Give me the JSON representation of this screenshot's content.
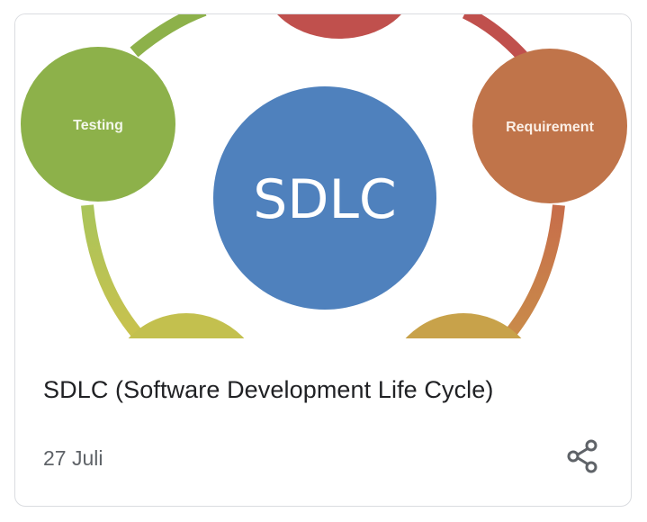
{
  "card": {
    "title": "SDLC (Software Development Life Cycle)",
    "date": "27 Juli"
  },
  "diagram": {
    "center_label": "SDLC",
    "left_label": "Testing",
    "right_label": "Requirement"
  },
  "icons": {
    "share": "share-icon"
  },
  "colors": {
    "center": "#4f81bd",
    "testing": "#8db14a",
    "requirement": "#c0744a",
    "top": "#c0504d"
  }
}
